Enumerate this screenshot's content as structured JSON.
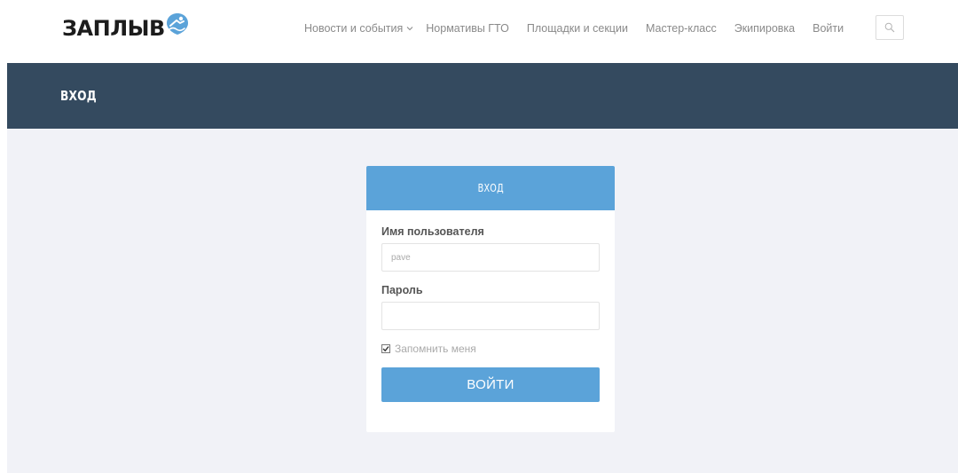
{
  "brand": {
    "logo_text": "ЗАПЛЫВ",
    "logo_color": "#1c1c1c",
    "badge_color": "#5ba3d9"
  },
  "nav": {
    "items": [
      {
        "label": "Новости и события",
        "has_dropdown": true
      },
      {
        "label": "Нормативы ГТО",
        "has_dropdown": false
      },
      {
        "label": "Площадки и секции",
        "has_dropdown": false
      },
      {
        "label": "Мастер-класс",
        "has_dropdown": false
      },
      {
        "label": "Экипировка",
        "has_dropdown": false
      },
      {
        "label": "Войти",
        "has_dropdown": false
      }
    ],
    "search_icon": "search-icon"
  },
  "page": {
    "title": "ВХОД",
    "title_bar_color": "#344a5f",
    "background_color": "#f1f2f7"
  },
  "login_form": {
    "header": "ВХОД",
    "accent_color": "#5ba3d9",
    "username": {
      "label": "Имя пользователя",
      "value": "pave"
    },
    "password": {
      "label": "Пароль",
      "value": ""
    },
    "remember": {
      "label": "Запомнить меня",
      "checked": true
    },
    "submit_label": "ВОЙТИ"
  }
}
